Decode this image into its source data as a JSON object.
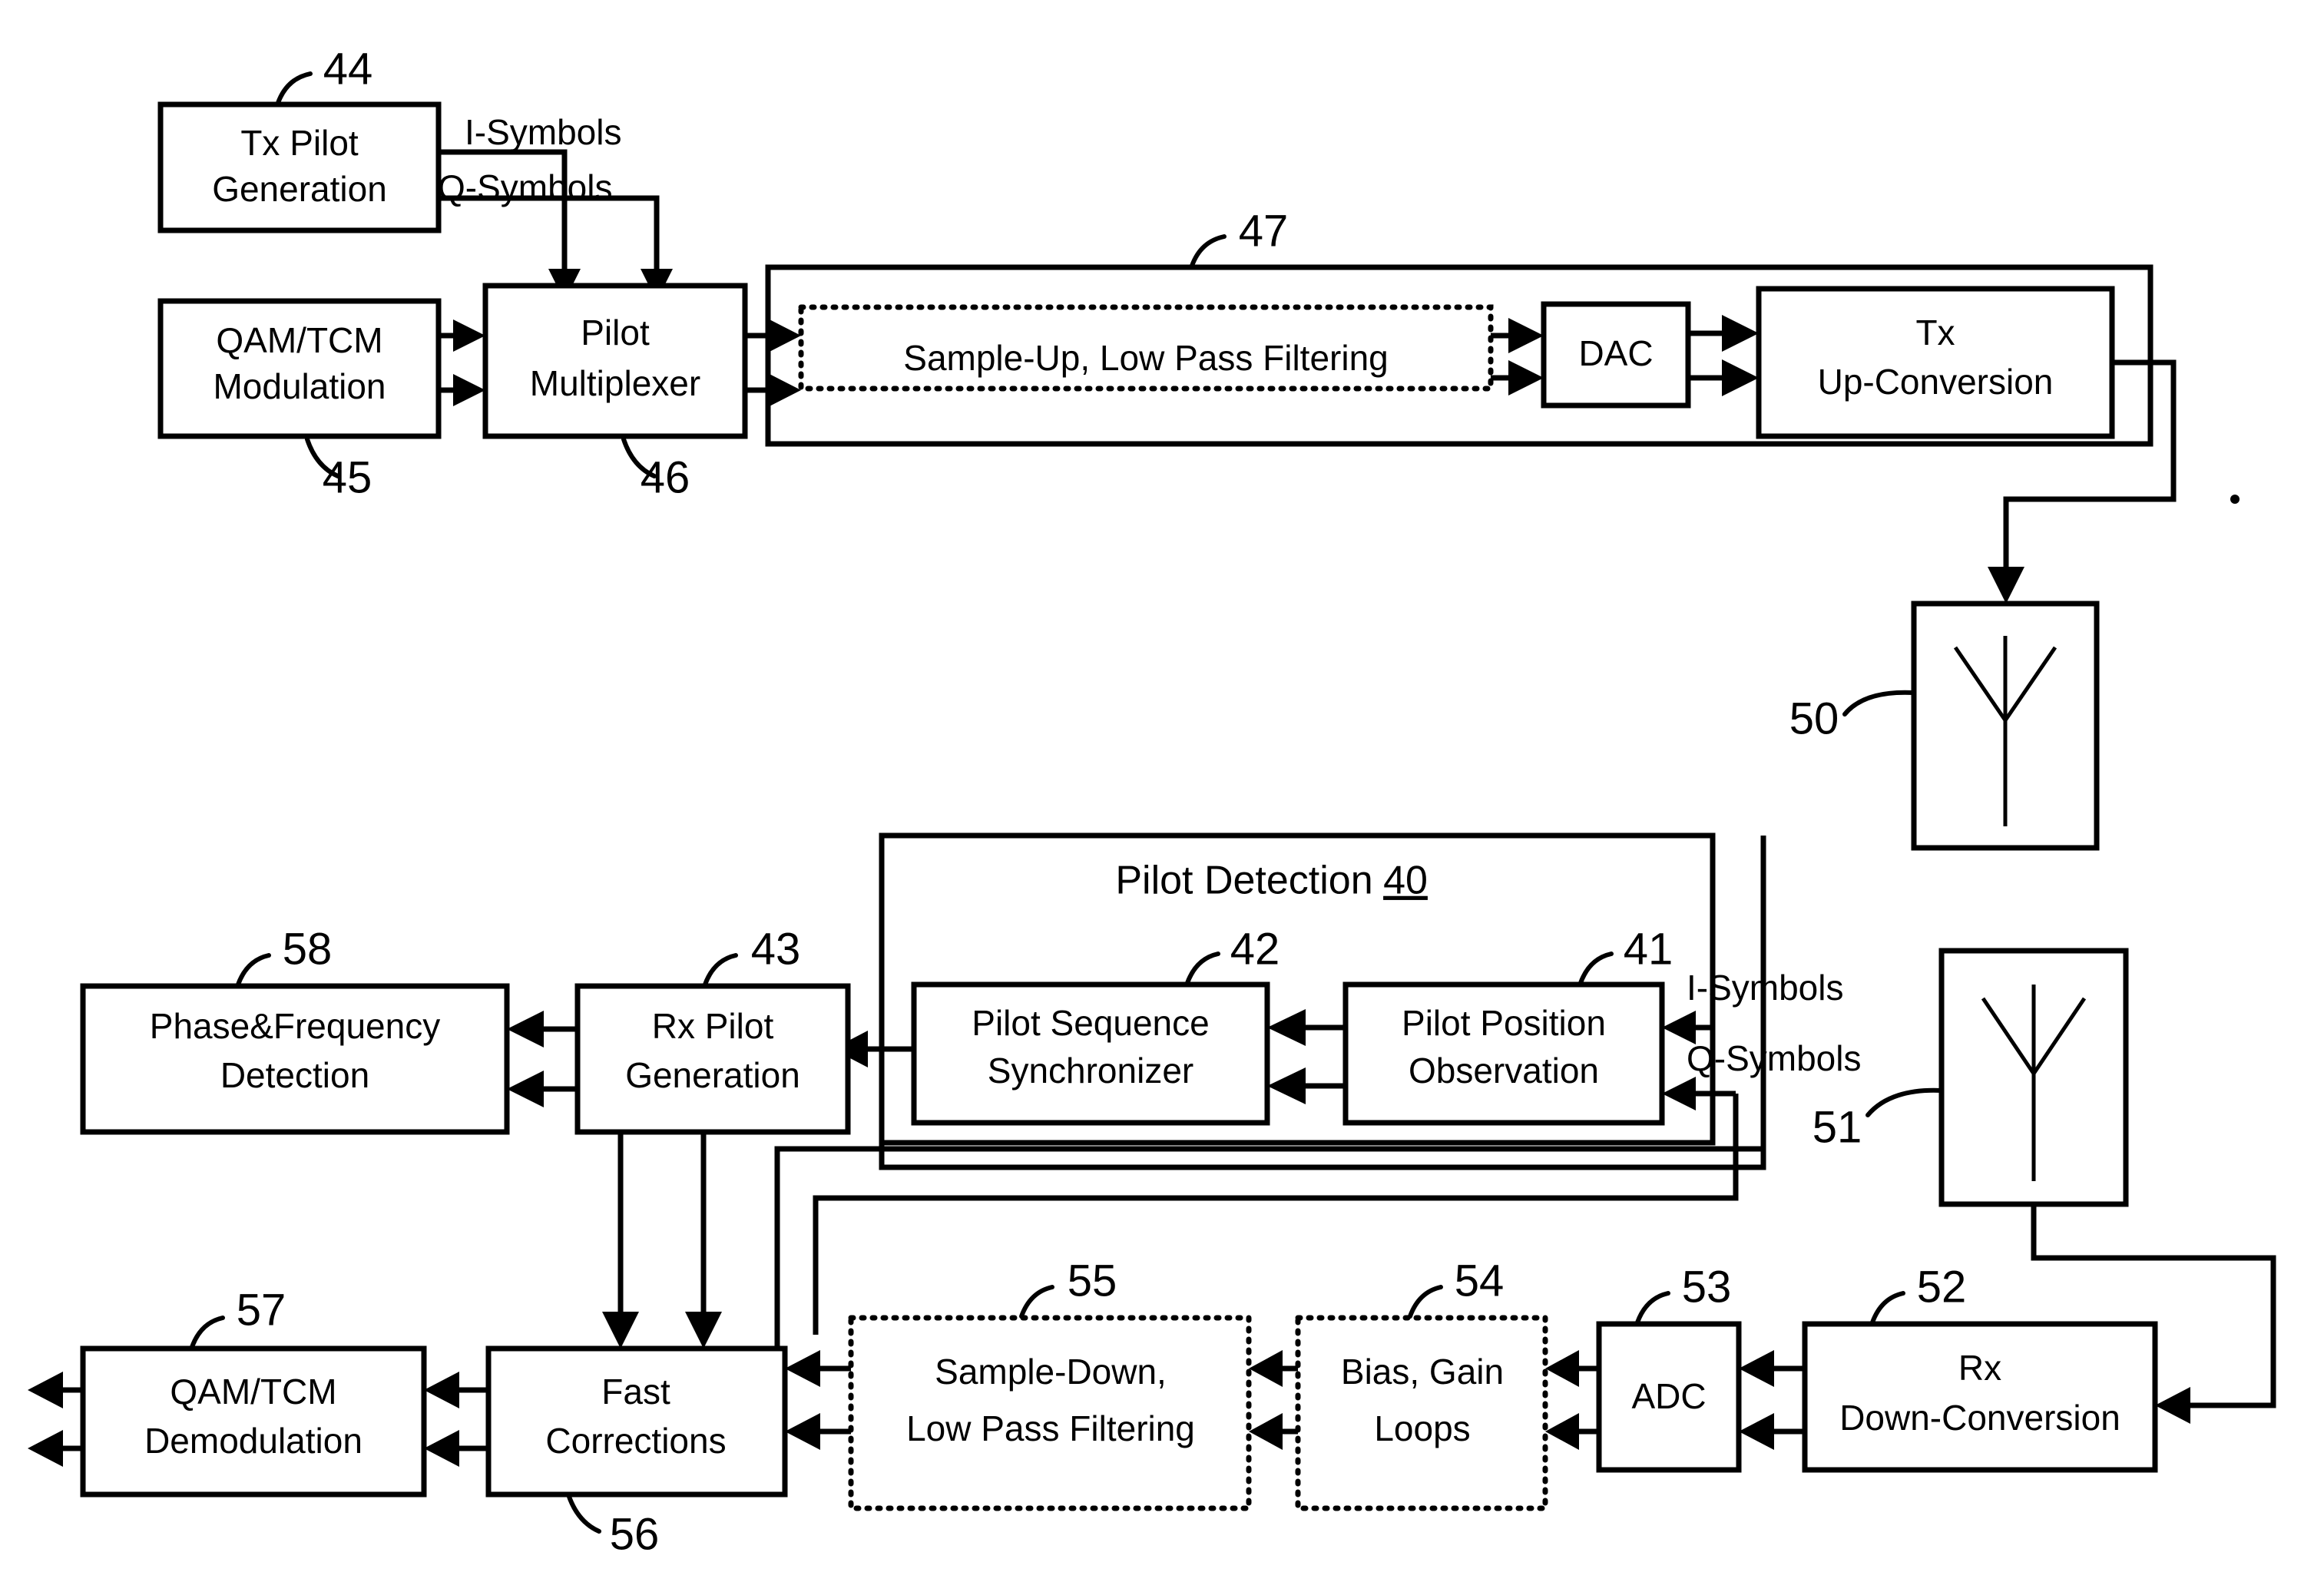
{
  "figure": {
    "kind": "patent-block-diagram",
    "subject": "Pilot-aided QAM/TCM transceiver with pilot detection",
    "line_color": "#000000",
    "background_color": "#ffffff"
  },
  "transmitter": {
    "blocks": [
      {
        "id": "tx-pilot-generation",
        "ref": "44",
        "line1": "Tx Pilot",
        "line2": "Generation",
        "style": "solid"
      },
      {
        "id": "qam-tcm-modulation",
        "ref": "45",
        "line1": "QAM/TCM",
        "line2": "Modulation",
        "style": "solid"
      },
      {
        "id": "pilot-multiplexer",
        "ref": "46",
        "line1": "Pilot",
        "line2": "Multiplexer",
        "style": "solid"
      },
      {
        "id": "sample-up-low-pass-filtering",
        "ref": "",
        "line1": "Sample-Up, Low Pass Filtering",
        "line2": "",
        "style": "dotted"
      },
      {
        "id": "dac",
        "ref": "",
        "line1": "DAC",
        "line2": "",
        "style": "solid"
      },
      {
        "id": "tx-up-conversion",
        "ref": "",
        "line1": "Tx",
        "line2": "Up-Conversion",
        "style": "solid"
      },
      {
        "id": "tx-antenna",
        "ref": "50",
        "line1": "",
        "line2": "",
        "style": "antenna"
      }
    ],
    "group_ref": "47",
    "signal_labels": {
      "i_symbols": "I-Symbols",
      "q_symbols": "Q-Symbols"
    }
  },
  "pilot_detection": {
    "title": "Pilot Detection",
    "title_ref": "40",
    "blocks": [
      {
        "id": "pilot-sequence-synchronizer",
        "ref": "42",
        "line1": "Pilot Sequence",
        "line2": "Synchronizer",
        "style": "solid"
      },
      {
        "id": "pilot-position-observation",
        "ref": "41",
        "line1": "Pilot Position",
        "line2": "Observation",
        "style": "solid"
      }
    ],
    "signal_labels": {
      "i_symbols": "I-Symbols",
      "q_symbols": "Q-Symbols"
    }
  },
  "receiver": {
    "blocks": [
      {
        "id": "phase-frequency-detection",
        "ref": "58",
        "line1": "Phase&Frequency",
        "line2": "Detection",
        "style": "solid"
      },
      {
        "id": "rx-pilot-generation",
        "ref": "43",
        "line1": "Rx Pilot",
        "line2": "Generation",
        "style": "solid"
      },
      {
        "id": "rx-antenna",
        "ref": "51",
        "line1": "",
        "line2": "",
        "style": "antenna"
      },
      {
        "id": "rx-down-conversion",
        "ref": "52",
        "line1": "Rx",
        "line2": "Down-Conversion",
        "style": "solid"
      },
      {
        "id": "adc",
        "ref": "53",
        "line1": "ADC",
        "line2": "",
        "style": "solid"
      },
      {
        "id": "bias-gain-loops",
        "ref": "54",
        "line1": "Bias, Gain",
        "line2": "Loops",
        "style": "dotted"
      },
      {
        "id": "sample-down-low-pass-filtering",
        "ref": "55",
        "line1": "Sample-Down,",
        "line2": "Low Pass Filtering",
        "style": "dotted"
      },
      {
        "id": "fast-corrections",
        "ref": "56",
        "line1": "Fast",
        "line2": "Corrections",
        "style": "solid"
      },
      {
        "id": "qam-tcm-demodulation",
        "ref": "57",
        "line1": "QAM/TCM",
        "line2": "Demodulation",
        "style": "solid"
      }
    ]
  },
  "reference_numerals": [
    "40",
    "41",
    "42",
    "43",
    "44",
    "45",
    "46",
    "47",
    "50",
    "51",
    "52",
    "53",
    "54",
    "55",
    "56",
    "57",
    "58"
  ]
}
